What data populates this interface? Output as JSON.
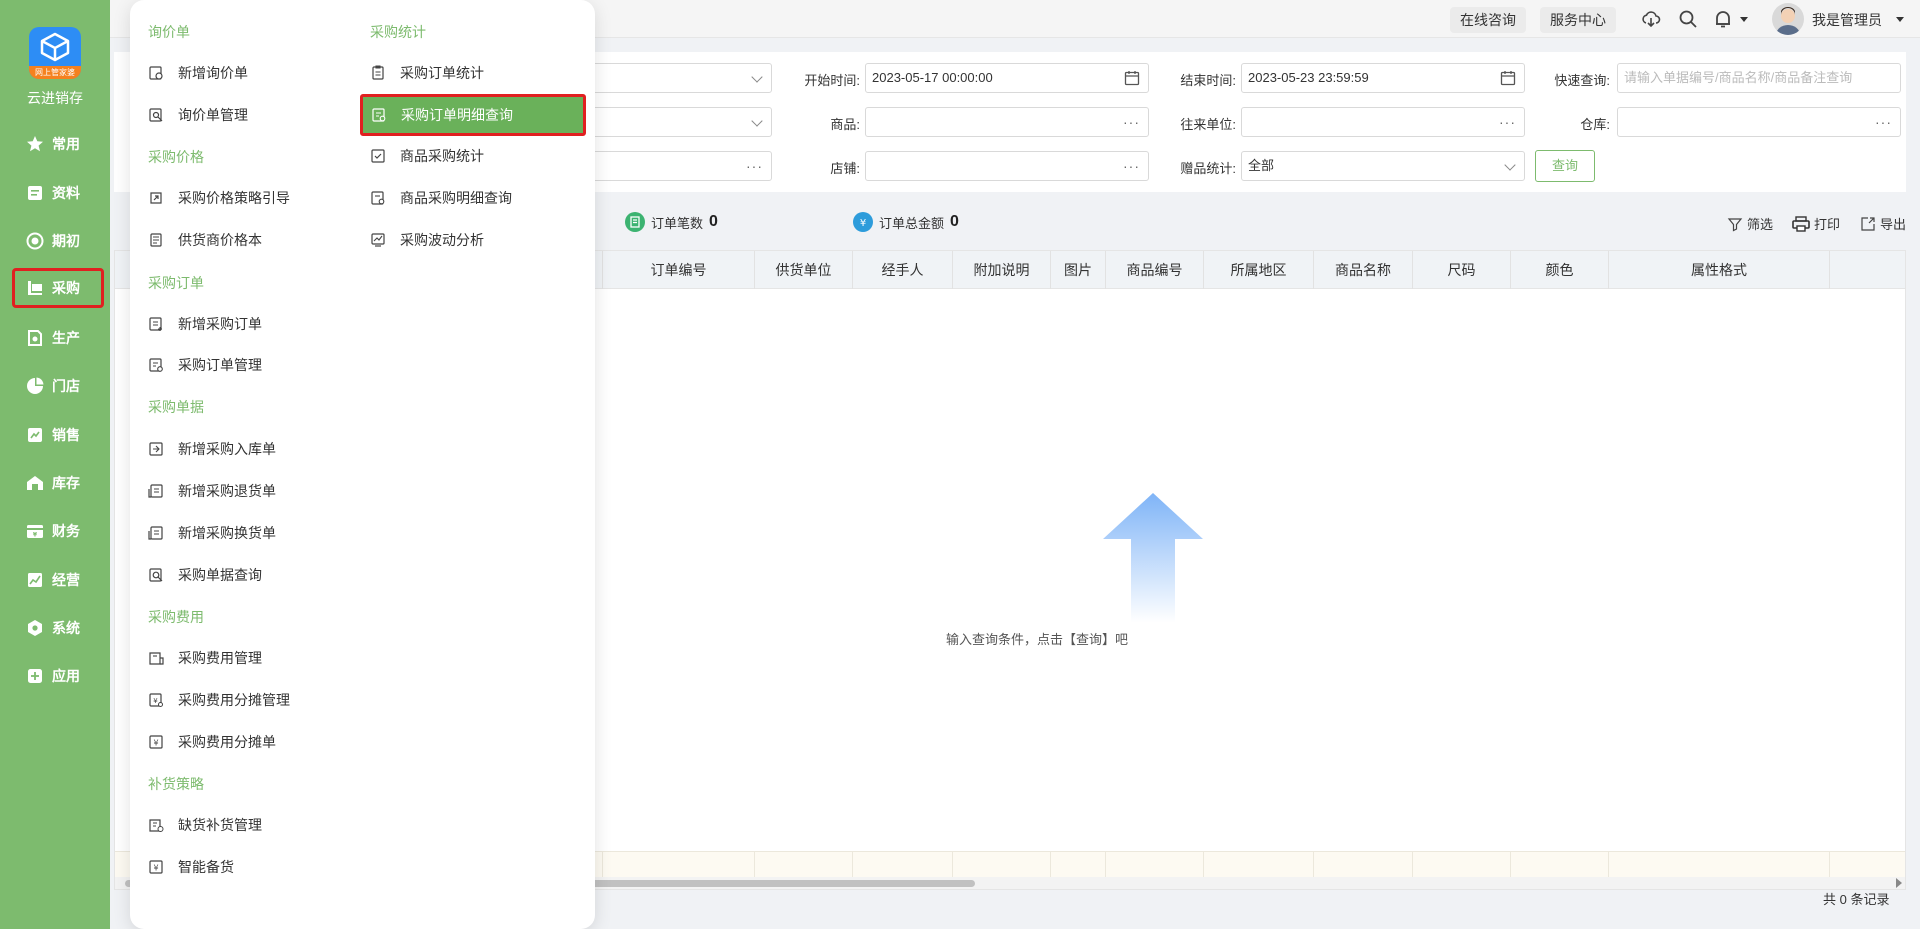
{
  "sidebar": {
    "app_name": "云进销存",
    "badge": "网上管家婆",
    "items": [
      {
        "label": "常用",
        "icon": "star-icon"
      },
      {
        "label": "资料",
        "icon": "document-icon"
      },
      {
        "label": "期初",
        "icon": "target-icon"
      },
      {
        "label": "采购",
        "icon": "purchase-icon",
        "active": true
      },
      {
        "label": "生产",
        "icon": "production-icon"
      },
      {
        "label": "门店",
        "icon": "pie-icon"
      },
      {
        "label": "销售",
        "icon": "sales-icon"
      },
      {
        "label": "库存",
        "icon": "warehouse-icon"
      },
      {
        "label": "财务",
        "icon": "finance-icon"
      },
      {
        "label": "经营",
        "icon": "chart-icon"
      },
      {
        "label": "系统",
        "icon": "gear-icon"
      },
      {
        "label": "应用",
        "icon": "plus-icon"
      }
    ]
  },
  "header": {
    "online_consult": "在线咨询",
    "service_center": "服务中心",
    "user_name": "我是管理员"
  },
  "filters": {
    "start_time_label": "开始时间:",
    "start_time_value": "2023-05-17 00:00:00",
    "end_time_label": "结束时间:",
    "end_time_value": "2023-05-23 23:59:59",
    "quick_search_label": "快速查询:",
    "quick_search_placeholder": "请输入单据编号/商品名称/商品备注查询",
    "product_label": "商品:",
    "partner_label": "往来单位:",
    "warehouse_label": "仓库:",
    "store_label": "店铺:",
    "gift_label": "赠品统计:",
    "gift_value": "全部",
    "query_button": "查询"
  },
  "summary": {
    "order_count_label": "订单笔数",
    "order_count_value": "0",
    "order_total_label": "订单总金额",
    "order_total_value": "0",
    "filter_tool": "筛选",
    "print_tool": "打印",
    "export_tool": "导出"
  },
  "table": {
    "columns": [
      "订单编号",
      "供货单位",
      "经手人",
      "附加说明",
      "图片",
      "商品编号",
      "所属地区",
      "商品名称",
      "尺码",
      "颜色",
      "属性格式"
    ],
    "empty_hint": "输入查询条件，点击【查询】吧",
    "total_records": "共 0 条记录"
  },
  "menu": {
    "col1": [
      {
        "kind": "head",
        "label": "询价单"
      },
      {
        "kind": "item",
        "label": "新增询价单",
        "icon": "quote-add-icon"
      },
      {
        "kind": "item",
        "label": "询价单管理",
        "icon": "quote-manage-icon"
      },
      {
        "kind": "head",
        "label": "采购价格"
      },
      {
        "kind": "item",
        "label": "采购价格策略引导",
        "icon": "price-guide-icon"
      },
      {
        "kind": "item",
        "label": "供货商价格本",
        "icon": "price-book-icon"
      },
      {
        "kind": "head",
        "label": "采购订单"
      },
      {
        "kind": "item",
        "label": "新增采购订单",
        "icon": "order-add-icon"
      },
      {
        "kind": "item",
        "label": "采购订单管理",
        "icon": "order-manage-icon"
      },
      {
        "kind": "head",
        "label": "采购单据"
      },
      {
        "kind": "item",
        "label": "新增采购入库单",
        "icon": "stock-in-icon"
      },
      {
        "kind": "item",
        "label": "新增采购退货单",
        "icon": "return-icon"
      },
      {
        "kind": "item",
        "label": "新增采购换货单",
        "icon": "exchange-icon"
      },
      {
        "kind": "item",
        "label": "采购单据查询",
        "icon": "doc-search-icon"
      },
      {
        "kind": "head",
        "label": "采购费用"
      },
      {
        "kind": "item",
        "label": "采购费用管理",
        "icon": "cost-manage-icon"
      },
      {
        "kind": "item",
        "label": "采购费用分摊管理",
        "icon": "cost-split-icon"
      },
      {
        "kind": "item",
        "label": "采购费用分摊单",
        "icon": "cost-split-doc-icon"
      },
      {
        "kind": "head",
        "label": "补货策略"
      },
      {
        "kind": "item",
        "label": "缺货补货管理",
        "icon": "restock-icon"
      },
      {
        "kind": "item",
        "label": "智能备货",
        "icon": "smart-stock-icon"
      }
    ],
    "col2": [
      {
        "kind": "head",
        "label": "采购统计"
      },
      {
        "kind": "item",
        "label": "采购订单统计",
        "icon": "order-stat-icon"
      },
      {
        "kind": "item",
        "label": "采购订单明细查询",
        "icon": "order-detail-icon",
        "highlighted": true
      },
      {
        "kind": "item",
        "label": "商品采购统计",
        "icon": "product-stat-icon"
      },
      {
        "kind": "item",
        "label": "商品采购明细查询",
        "icon": "product-detail-icon"
      },
      {
        "kind": "item",
        "label": "采购波动分析",
        "icon": "fluctuation-icon"
      }
    ]
  },
  "colors": {
    "accent": "#7dbb6e",
    "highlight_border": "#e02020",
    "highlight_fill": "#6ab15a",
    "logo_blue": "#2d8df5"
  }
}
